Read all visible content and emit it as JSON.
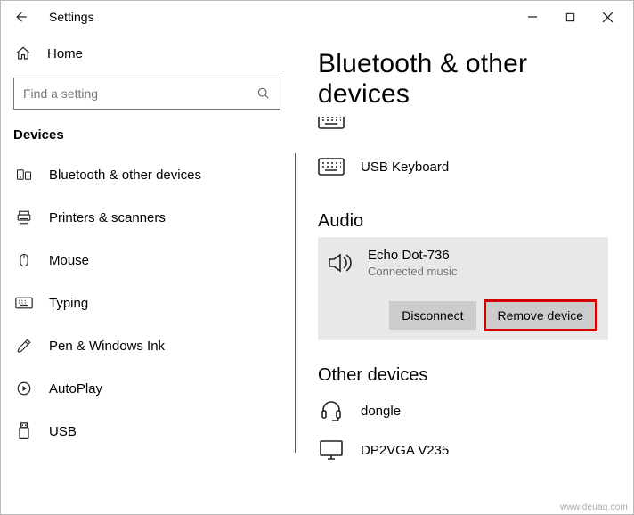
{
  "window": {
    "title": "Settings"
  },
  "sidebar": {
    "home_label": "Home",
    "search_placeholder": "Find a setting",
    "heading": "Devices",
    "items": [
      {
        "label": "Bluetooth & other devices"
      },
      {
        "label": "Printers & scanners"
      },
      {
        "label": "Mouse"
      },
      {
        "label": "Typing"
      },
      {
        "label": "Pen & Windows Ink"
      },
      {
        "label": "AutoPlay"
      },
      {
        "label": "USB"
      }
    ]
  },
  "page": {
    "title": "Bluetooth & other devices",
    "clipped_device_label": "",
    "usb_keyboard_label": "USB Keyboard",
    "audio_heading": "Audio",
    "audio_device": {
      "name": "Echo Dot-736",
      "status": "Connected music",
      "disconnect_label": "Disconnect",
      "remove_label": "Remove device"
    },
    "other_heading": "Other devices",
    "other_devices": [
      {
        "label": "dongle"
      },
      {
        "label": "DP2VGA V235"
      }
    ]
  },
  "watermark": "www.deuaq.com"
}
